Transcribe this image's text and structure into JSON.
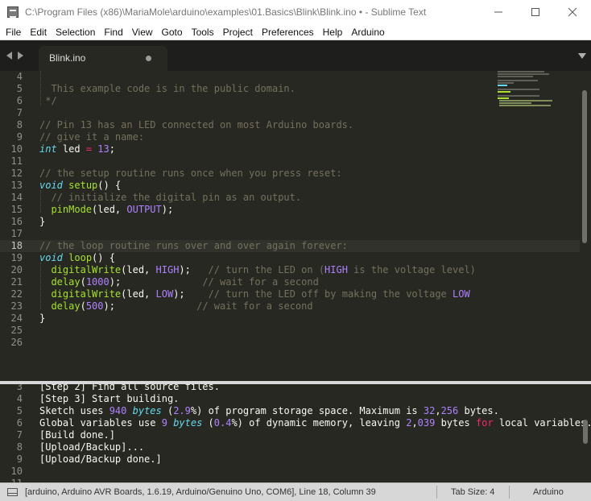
{
  "window": {
    "title": "C:\\Program Files (x86)\\MariaMole\\arduino\\examples\\01.Basics\\Blink\\Blink.ino • - Sublime Text",
    "min_glyph": "—",
    "max_glyph": "☐",
    "close_glyph": "✕",
    "icons": {
      "app": "sublime-text-icon",
      "minimize": "minimize-icon",
      "maximize": "maximize-icon",
      "close": "close-icon"
    }
  },
  "menu": [
    "File",
    "Edit",
    "Selection",
    "Find",
    "View",
    "Goto",
    "Tools",
    "Project",
    "Preferences",
    "Help",
    "Arduino"
  ],
  "tabs": {
    "active": {
      "label": "Blink.ino",
      "dirty": true
    },
    "icons": {
      "back": "arrow-left-icon",
      "forward": "arrow-right-icon",
      "dirty": "unsaved-dot-icon",
      "list": "tab-list-chevron-icon"
    }
  },
  "editor": {
    "current_line": 18,
    "lines": [
      {
        "n": "4",
        "segs": [
          {
            "t": ""
          }
        ]
      },
      {
        "n": "5",
        "segs": [
          {
            "t": "  This example code is in the public domain.",
            "c": "cm"
          }
        ]
      },
      {
        "n": "6",
        "segs": [
          {
            "t": " */",
            "c": "cm"
          }
        ]
      },
      {
        "n": "7",
        "segs": [
          {
            "t": ""
          }
        ]
      },
      {
        "n": "8",
        "segs": [
          {
            "t": "// Pin 13 has an LED connected on most Arduino boards.",
            "c": "cm"
          }
        ]
      },
      {
        "n": "9",
        "segs": [
          {
            "t": "// give it a name:",
            "c": "cm"
          }
        ]
      },
      {
        "n": "10",
        "segs": [
          {
            "t": "int",
            "c": "kw"
          },
          {
            "t": " led "
          },
          {
            "t": "=",
            "c": "op"
          },
          {
            "t": " "
          },
          {
            "t": "13",
            "c": "num"
          },
          {
            "t": ";"
          }
        ]
      },
      {
        "n": "11",
        "segs": [
          {
            "t": ""
          }
        ]
      },
      {
        "n": "12",
        "segs": [
          {
            "t": "// the setup routine runs once when you press reset:",
            "c": "cm"
          }
        ]
      },
      {
        "n": "13",
        "segs": [
          {
            "t": "void",
            "c": "kw"
          },
          {
            "t": " "
          },
          {
            "t": "setup",
            "c": "fn"
          },
          {
            "t": "() {"
          }
        ]
      },
      {
        "n": "14",
        "segs": [
          {
            "t": "  // initialize the digital pin as an output.",
            "c": "cm"
          }
        ]
      },
      {
        "n": "15",
        "segs": [
          {
            "t": "  "
          },
          {
            "t": "pinMode",
            "c": "fn"
          },
          {
            "t": "(led, "
          },
          {
            "t": "OUTPUT",
            "c": "cst"
          },
          {
            "t": ");"
          }
        ]
      },
      {
        "n": "16",
        "segs": [
          {
            "t": "}"
          }
        ]
      },
      {
        "n": "17",
        "segs": [
          {
            "t": ""
          }
        ]
      },
      {
        "n": "18",
        "segs": [
          {
            "t": "// the loop routine runs over and over again forever:",
            "c": "cm"
          }
        ]
      },
      {
        "n": "19",
        "segs": [
          {
            "t": "void",
            "c": "kw"
          },
          {
            "t": " "
          },
          {
            "t": "loop",
            "c": "fn"
          },
          {
            "t": "() {"
          }
        ]
      },
      {
        "n": "20",
        "segs": [
          {
            "t": "  "
          },
          {
            "t": "digitalWrite",
            "c": "fn"
          },
          {
            "t": "(led, "
          },
          {
            "t": "HIGH",
            "c": "cst"
          },
          {
            "t": ");   "
          },
          {
            "t": "// turn the LED on (",
            "c": "cm"
          },
          {
            "t": "HIGH",
            "c": "cst"
          },
          {
            "t": " is the voltage level)",
            "c": "cm"
          }
        ]
      },
      {
        "n": "21",
        "segs": [
          {
            "t": "  "
          },
          {
            "t": "delay",
            "c": "fn"
          },
          {
            "t": "("
          },
          {
            "t": "1000",
            "c": "num"
          },
          {
            "t": ");              "
          },
          {
            "t": "// wait for a second",
            "c": "cm"
          }
        ]
      },
      {
        "n": "22",
        "segs": [
          {
            "t": "  "
          },
          {
            "t": "digitalWrite",
            "c": "fn"
          },
          {
            "t": "(led, "
          },
          {
            "t": "LOW",
            "c": "cst"
          },
          {
            "t": ");    "
          },
          {
            "t": "// turn the LED off by making the voltage ",
            "c": "cm"
          },
          {
            "t": "LOW",
            "c": "cst"
          }
        ]
      },
      {
        "n": "23",
        "segs": [
          {
            "t": "  "
          },
          {
            "t": "delay",
            "c": "fn"
          },
          {
            "t": "("
          },
          {
            "t": "500",
            "c": "num"
          },
          {
            "t": ");              "
          },
          {
            "t": "// wait for a second",
            "c": "cm"
          }
        ]
      },
      {
        "n": "24",
        "segs": [
          {
            "t": "}"
          }
        ]
      },
      {
        "n": "25",
        "segs": [
          {
            "t": ""
          }
        ]
      },
      {
        "n": "26",
        "segs": [
          {
            "t": ""
          }
        ]
      }
    ]
  },
  "output": {
    "lines": [
      {
        "n": "3",
        "segs": [
          {
            "t": "[Step 2] Find all source files."
          }
        ]
      },
      {
        "n": "4",
        "segs": [
          {
            "t": "[Step 3] Start building."
          }
        ]
      },
      {
        "n": "5",
        "segs": [
          {
            "t": "Sketch uses "
          },
          {
            "t": "940",
            "c": "num"
          },
          {
            "t": " "
          },
          {
            "t": "bytes",
            "c": "kw2"
          },
          {
            "t": " ("
          },
          {
            "t": "2.9",
            "c": "num"
          },
          {
            "t": "%) of program storage space. Maximum is "
          },
          {
            "t": "32",
            "c": "num"
          },
          {
            "t": ","
          },
          {
            "t": "256",
            "c": "num"
          },
          {
            "t": " bytes."
          }
        ]
      },
      {
        "n": "6",
        "segs": [
          {
            "t": "Global variables use "
          },
          {
            "t": "9",
            "c": "num"
          },
          {
            "t": " "
          },
          {
            "t": "bytes",
            "c": "kw2"
          },
          {
            "t": " ("
          },
          {
            "t": "0.4",
            "c": "num"
          },
          {
            "t": "%) of dynamic memory, leaving "
          },
          {
            "t": "2",
            "c": "num"
          },
          {
            "t": ","
          },
          {
            "t": "039",
            "c": "num"
          },
          {
            "t": " bytes "
          },
          {
            "t": "for",
            "c": "op"
          },
          {
            "t": " local variables."
          }
        ]
      },
      {
        "n": "7",
        "segs": [
          {
            "t": "[Build done.]"
          }
        ]
      },
      {
        "n": "8",
        "segs": [
          {
            "t": "[Upload/Backup]..."
          }
        ]
      },
      {
        "n": "9",
        "segs": [
          {
            "t": "[Upload/Backup done.]"
          }
        ]
      },
      {
        "n": "10",
        "segs": [
          {
            "t": ""
          }
        ]
      },
      {
        "n": "11",
        "segs": [
          {
            "t": ""
          }
        ]
      }
    ]
  },
  "status": {
    "text": "[arduino, Arduino AVR Boards, 1.6.19, Arduino/Genuino Uno, COM6], Line 18, Column 39",
    "tab_size": "Tab Size: 4",
    "syntax": "Arduino",
    "icon": "panel-toggle-icon"
  },
  "colors": {
    "background": "#272822",
    "comment": "#75715e",
    "keyword": "#66d9ef",
    "function": "#a6e22e",
    "number": "#ae81ff",
    "operator": "#f92672",
    "text": "#f8f8f2",
    "statusbar": "#d7d7d7"
  }
}
